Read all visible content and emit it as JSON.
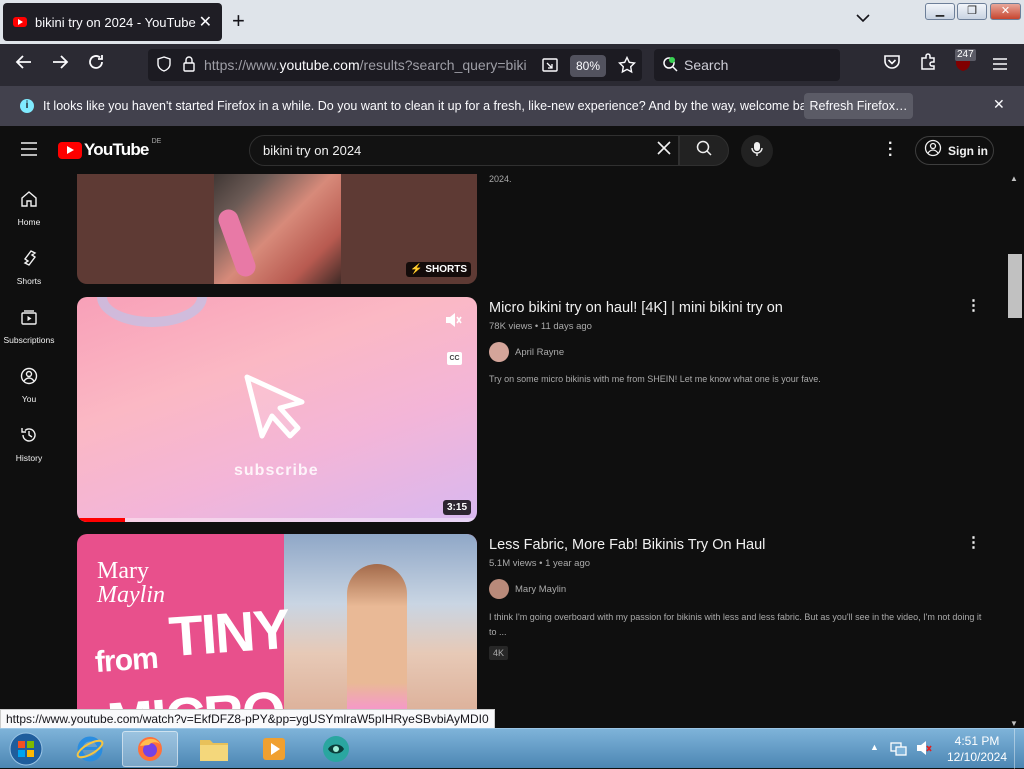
{
  "browser": {
    "tab_title": "bikini try on 2024 - YouTube",
    "tab_close": "✕",
    "new_tab": "+",
    "url_prefix": "https://www.",
    "url_domain": "youtube.com",
    "url_rest": "/results?search_query=biki",
    "zoom": "80%",
    "search_placeholder": "Search",
    "extension_badge": "247"
  },
  "notification": {
    "message": "It looks like you haven't started Firefox in a while. Do you want to clean it up for a fresh, like-new experience? And by the way, welcome back!",
    "button": "Refresh Firefox…"
  },
  "youtube": {
    "logo_text": "YouTube",
    "region": "DE",
    "search_value": "bikini try on 2024",
    "sign_in": "Sign in",
    "sidebar": [
      {
        "label": "Home",
        "icon": "home-icon"
      },
      {
        "label": "Shorts",
        "icon": "shorts-icon"
      },
      {
        "label": "Subscriptions",
        "icon": "subscriptions-icon"
      },
      {
        "label": "You",
        "icon": "you-icon"
      },
      {
        "label": "History",
        "icon": "history-icon"
      }
    ],
    "partial_desc_end": "2024.",
    "shorts_badge": "SHORTS",
    "videos": [
      {
        "title": "Micro bikini try on haul! [4K] | mini bikini try on",
        "meta": "78K views • 11 days ago",
        "channel": "April Rayne",
        "description": "Try on some micro bikinis with me from SHEIN! Let me know what one is your fave.",
        "duration": "3:15",
        "thumb_text": "subscribe",
        "cc": "CC"
      },
      {
        "title": "Less Fabric, More Fab! Bikinis Try On Haul",
        "meta": "5.1M views • 1 year ago",
        "channel": "Mary Maylin",
        "description": "I think I'm going overboard with my passion for bikinis with less and less fabric. But as you'll see in the video, I'm not doing it to ...",
        "badge": "4K",
        "thumb_brand1": "Mary",
        "thumb_brand2": "Maylin",
        "thumb_big1": "TINY",
        "thumb_big2": "from",
        "thumb_big3": "MICRO"
      }
    ]
  },
  "status_url": "https://www.youtube.com/watch?v=EkfDFZ8-pPY&pp=ygUSYmlraW5pIHRyeSBvbiAyMDI0",
  "taskbar": {
    "time": "4:51 PM",
    "date": "12/10/2024"
  },
  "colors": {
    "yt_red": "#ff0000",
    "yt_bg": "#0f0f0f",
    "firefox_toolbar": "#2b2a33"
  }
}
